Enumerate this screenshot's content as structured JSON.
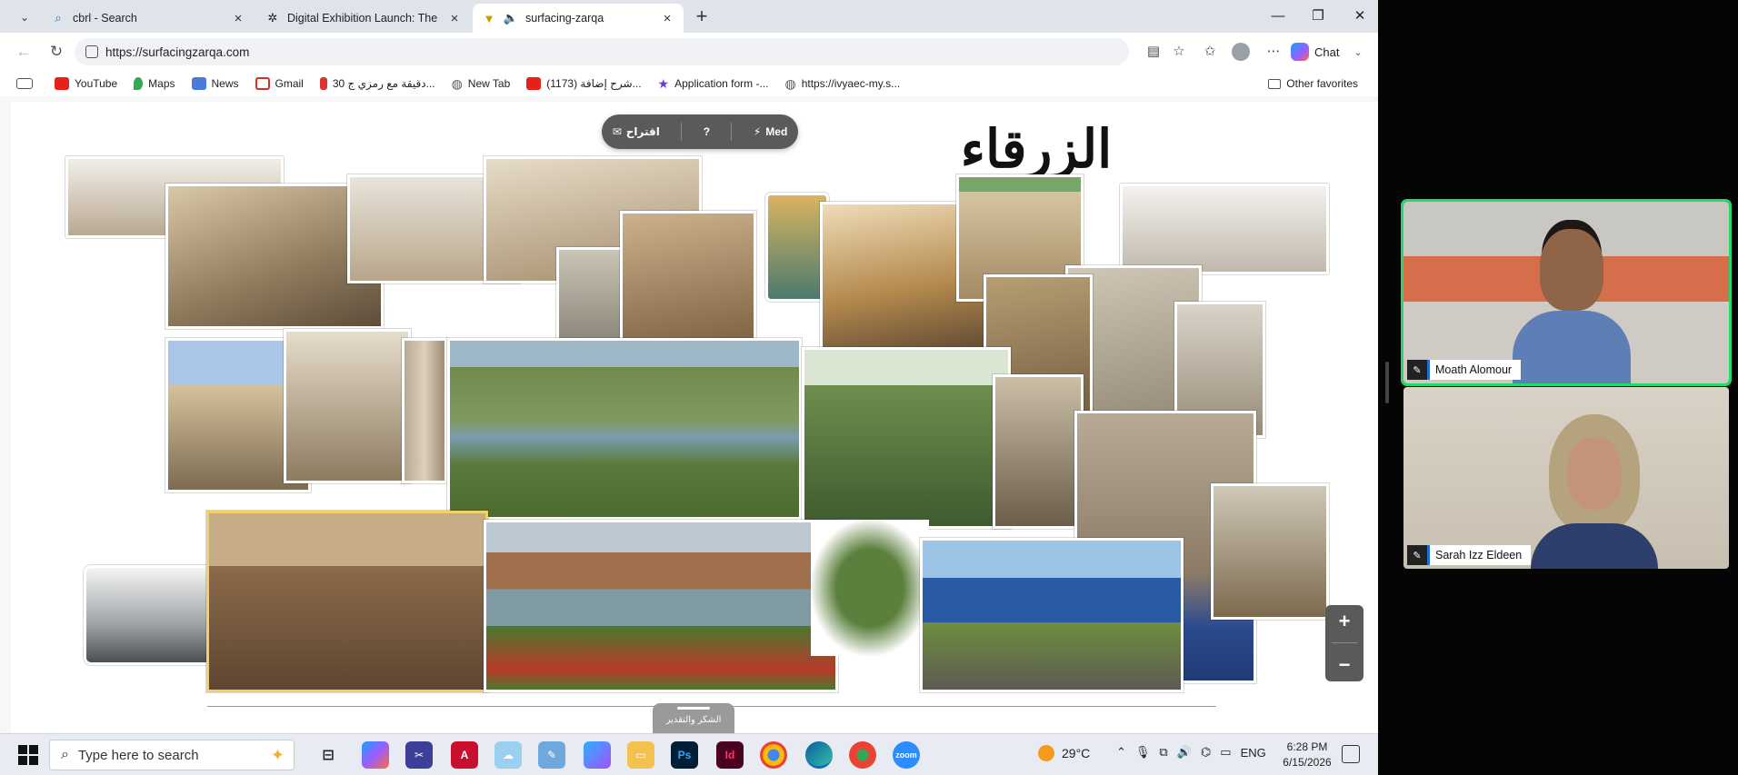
{
  "browser": {
    "tabs": [
      {
        "title": "cbrl - Search",
        "icon": "search-icon",
        "active": false
      },
      {
        "title": "Digital Exhibition Launch: The Surfi",
        "icon": "gear-icon",
        "active": false
      },
      {
        "title": "surfacing-zarqa",
        "icon": "speaker-icon",
        "active": true
      }
    ],
    "url": "https://surfacingzarqa.com",
    "chat_label": "Chat",
    "favorites": [
      {
        "label": "YouTube",
        "icon": "youtube-icon",
        "color": "#e62117"
      },
      {
        "label": "Maps",
        "icon": "maps-icon",
        "color": "#34a853"
      },
      {
        "label": "News",
        "icon": "news-icon",
        "color": "#4a7bd8"
      },
      {
        "label": "Gmail",
        "icon": "gmail-icon",
        "color": "#d93025"
      },
      {
        "label": "30 دقيقة مع رمزي ج...",
        "icon": "bookmark-icon",
        "color": "#d33"
      },
      {
        "label": "New Tab",
        "icon": "globe-icon",
        "color": "#555"
      },
      {
        "label": "(1173) شرح إضافة...",
        "icon": "youtube-icon",
        "color": "#e62117"
      },
      {
        "label": "Application form -...",
        "icon": "star-icon",
        "color": "#6a3fc8"
      },
      {
        "label": "https://ivyaec-my.s...",
        "icon": "globe-icon",
        "color": "#555"
      }
    ],
    "other_favorites": "Other favorites"
  },
  "site": {
    "title": "الزرقاء",
    "toolbar": {
      "suggest_label": "اقتراح",
      "help_label": "?",
      "mode_label": "Med"
    },
    "zoom_in": "+",
    "zoom_out": "−",
    "thanks_label": "الشكر والتقدير"
  },
  "taskbar": {
    "search_placeholder": "Type here to search",
    "temperature": "29°C",
    "language": "ENG",
    "time": "6:28 PM",
    "date": "6/15/2026"
  },
  "call": {
    "participants": [
      {
        "name": "Moath Alomour",
        "speaking": true
      },
      {
        "name": "Sarah Izz Eldeen",
        "speaking": false
      }
    ]
  }
}
